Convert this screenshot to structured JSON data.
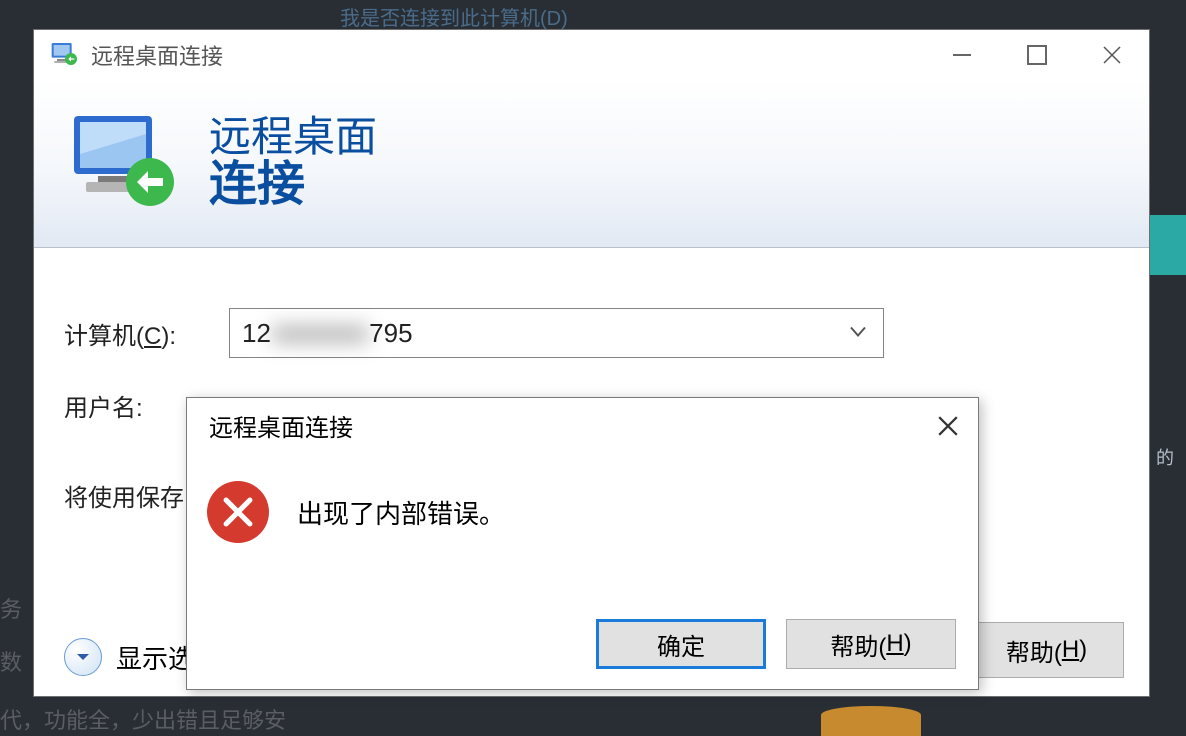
{
  "background": {
    "top_text": "我是否连接到此计算机(D)",
    "left_text1": "务",
    "left_text2": "数",
    "left_text3": "代，功能全，少出错且足够安",
    "right_small": "的"
  },
  "window": {
    "title": "远程桌面连接",
    "banner_line1": "远程桌面",
    "banner_line2": "连接",
    "computer_label_pre": "计算机(",
    "computer_label_u": "C",
    "computer_label_post": "):",
    "computer_value_pre": "12",
    "computer_value_blur": "■■■■■■",
    "computer_value_post": "795",
    "username_label": "用户名:",
    "saved_cred_text": "将使用保存",
    "show_options": "显示选",
    "help_pre": "帮助(",
    "help_u": "H",
    "help_post": ")"
  },
  "error": {
    "title": "远程桌面连接",
    "message": "出现了内部错误。",
    "ok": "确定",
    "help_pre": "帮助(",
    "help_u": "H",
    "help_post": ")"
  }
}
